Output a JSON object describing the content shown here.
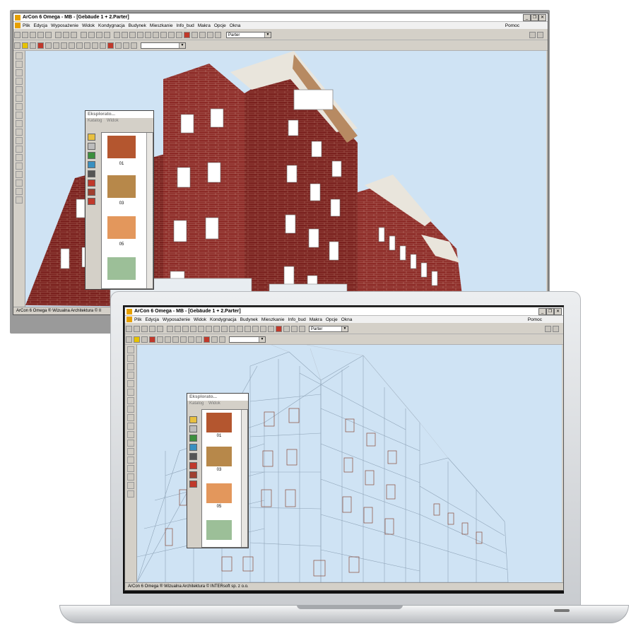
{
  "app": {
    "title": "ArCon 6 Omega - MB - [Gebäude 1 + 2.Parter]",
    "menu": [
      "Plik",
      "Edycja",
      "Wyposażenie",
      "Widok",
      "Kondygnacja",
      "Budynek",
      "Mieszkanie",
      "Info_bud",
      "Makra",
      "Opcje",
      "Okna"
    ],
    "help": "Pomoc",
    "floor_select": "Parter",
    "status_monitor": "ArCon 6 Omega ® Wizualna Architektura © II",
    "status_laptop": "ArCon 6 Omega ® Wizualna Architektura © INTERsoft sp. z o.o."
  },
  "explorer": {
    "title": "Eksplorato...",
    "tabs": [
      "Katalog",
      "Widok"
    ],
    "swatches": [
      {
        "label": "01",
        "color": "#b4562f"
      },
      {
        "label": "03",
        "color": "#b7884a"
      },
      {
        "label": "05",
        "color": "#e3975c"
      },
      {
        "label": "",
        "color": "#9cbf98"
      }
    ]
  },
  "colors": {
    "brick": "#8c2a26",
    "sky": "#cfe3f4",
    "wire": "#8b4a3a"
  }
}
